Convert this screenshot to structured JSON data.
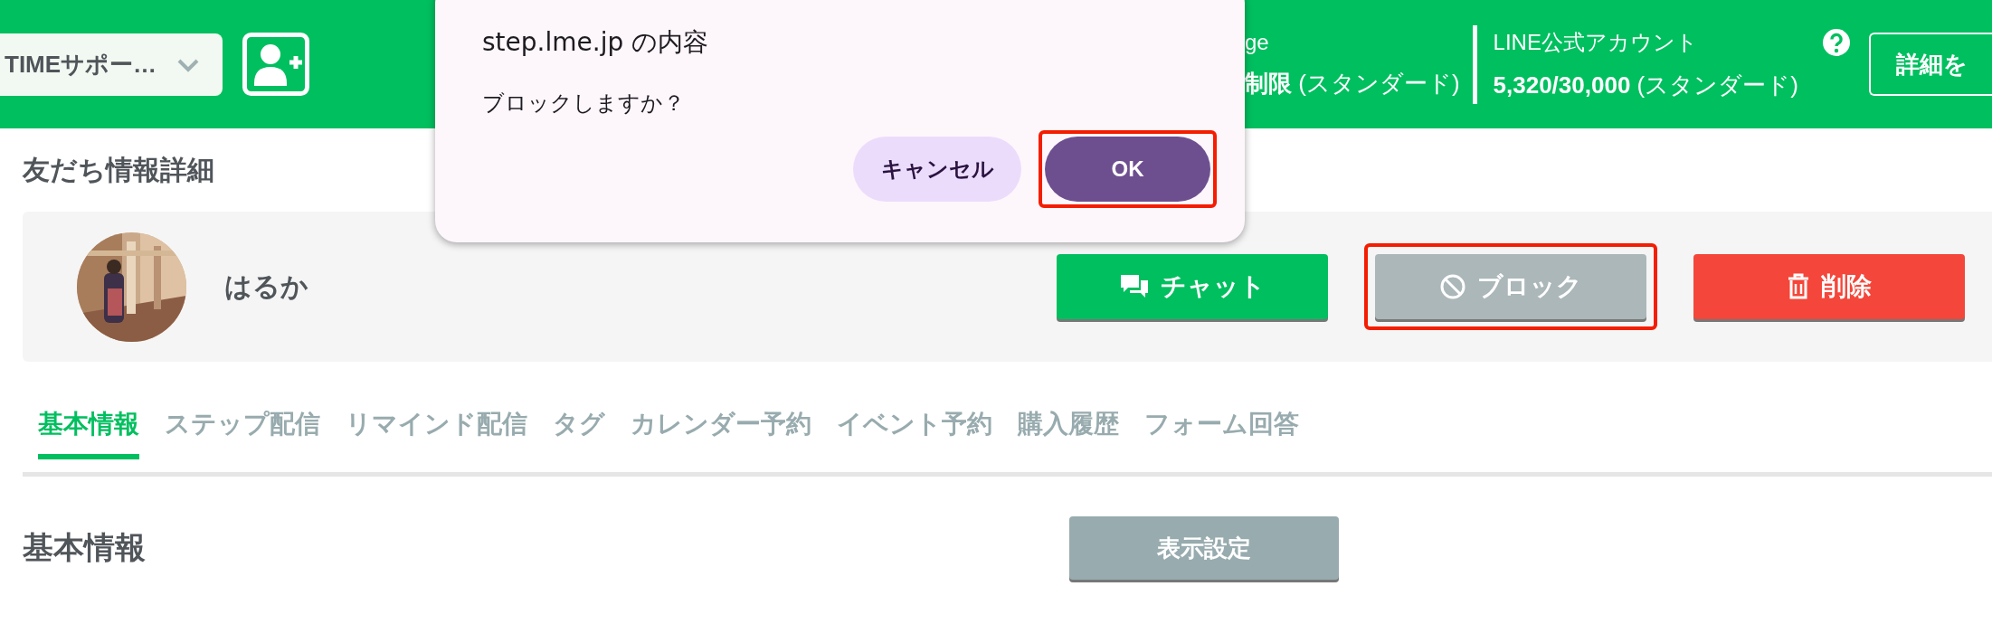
{
  "header": {
    "account_select": {
      "value": "TIMEサポー…"
    },
    "usage": [
      {
        "label": "ge",
        "value": "**制限** (スタンダード)",
        "help": false
      },
      {
        "label": "LINE公式アカウント",
        "value": "**5,320/30,000** (スタンダード)",
        "help": true
      }
    ],
    "details_button": "詳細を"
  },
  "dialog": {
    "title": "step.lme.jp の内容",
    "message": "ブロックしますか？",
    "buttons": [
      {
        "label": "キャンセル",
        "kind": "secondary",
        "highlighted": false
      },
      {
        "label": "OK",
        "kind": "primary",
        "highlighted": true
      }
    ]
  },
  "page_title": "友だち情報詳細",
  "profile": {
    "name": "はるか",
    "actions": [
      {
        "label": "チャット",
        "kind": "chat",
        "highlighted": false
      },
      {
        "label": "ブロック",
        "kind": "block",
        "highlighted": true
      },
      {
        "label": "削除",
        "kind": "delete",
        "highlighted": false
      }
    ]
  },
  "tabs": [
    {
      "label": "基本情報",
      "selected": true
    },
    {
      "label": "ステップ配信",
      "selected": false
    },
    {
      "label": "リマインド配信",
      "selected": false
    },
    {
      "label": "タグ",
      "selected": false
    },
    {
      "label": "カレンダー予約",
      "selected": false
    },
    {
      "label": "イベント予約",
      "selected": false
    },
    {
      "label": "購入履歴",
      "selected": false
    },
    {
      "label": "フォーム回答",
      "selected": false
    }
  ],
  "section": {
    "title": "基本情報",
    "button": "表示設定"
  }
}
